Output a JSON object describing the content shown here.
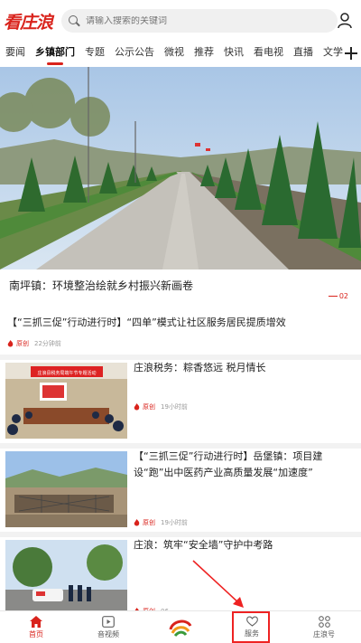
{
  "header": {
    "logo_text": "看庄浪",
    "search_placeholder": "请输入搜索的关键词"
  },
  "tabs": [
    {
      "label": "要闻"
    },
    {
      "label": "乡镇部门",
      "active": true
    },
    {
      "label": "专题"
    },
    {
      "label": "公示公告"
    },
    {
      "label": "微视"
    },
    {
      "label": "推荐"
    },
    {
      "label": "快讯"
    },
    {
      "label": "看电视"
    },
    {
      "label": "直播"
    },
    {
      "label": "文学"
    }
  ],
  "hero": {
    "title": "南坪镇：环境整治绘就乡村振兴新画卷",
    "page_indicator": "02"
  },
  "news": [
    {
      "title": "【“三抓三促”行动进行时】“四单”模式让社区服务居民提质增效",
      "source": "原创",
      "time": "22分钟前"
    },
    {
      "title": "庄浪税务：粽香悠远 税月情长",
      "source": "原创",
      "time": "19小时前",
      "thumb_banner": "庄浪县税务局端午节专题活动"
    },
    {
      "title": "【“三抓三促”行动进行时】岳堡镇：项目建设“跑”出中医药产业高质量发展“加速度”",
      "source": "原创",
      "time": "19小时前"
    },
    {
      "title": "庄浪：筑牢“安全墙”守护中考路",
      "source": "原创",
      "time": "06"
    }
  ],
  "bottom_nav": [
    {
      "label": "首页",
      "icon": "home-icon",
      "active": true
    },
    {
      "label": "音视频",
      "icon": "video-icon"
    },
    {
      "label": "",
      "icon": "center-logo-icon"
    },
    {
      "label": "服务",
      "icon": "heart-icon"
    },
    {
      "label": "庄浪号",
      "icon": "grid-icon"
    }
  ],
  "colors": {
    "accent": "#d9231c",
    "annotation": "#e22222"
  }
}
